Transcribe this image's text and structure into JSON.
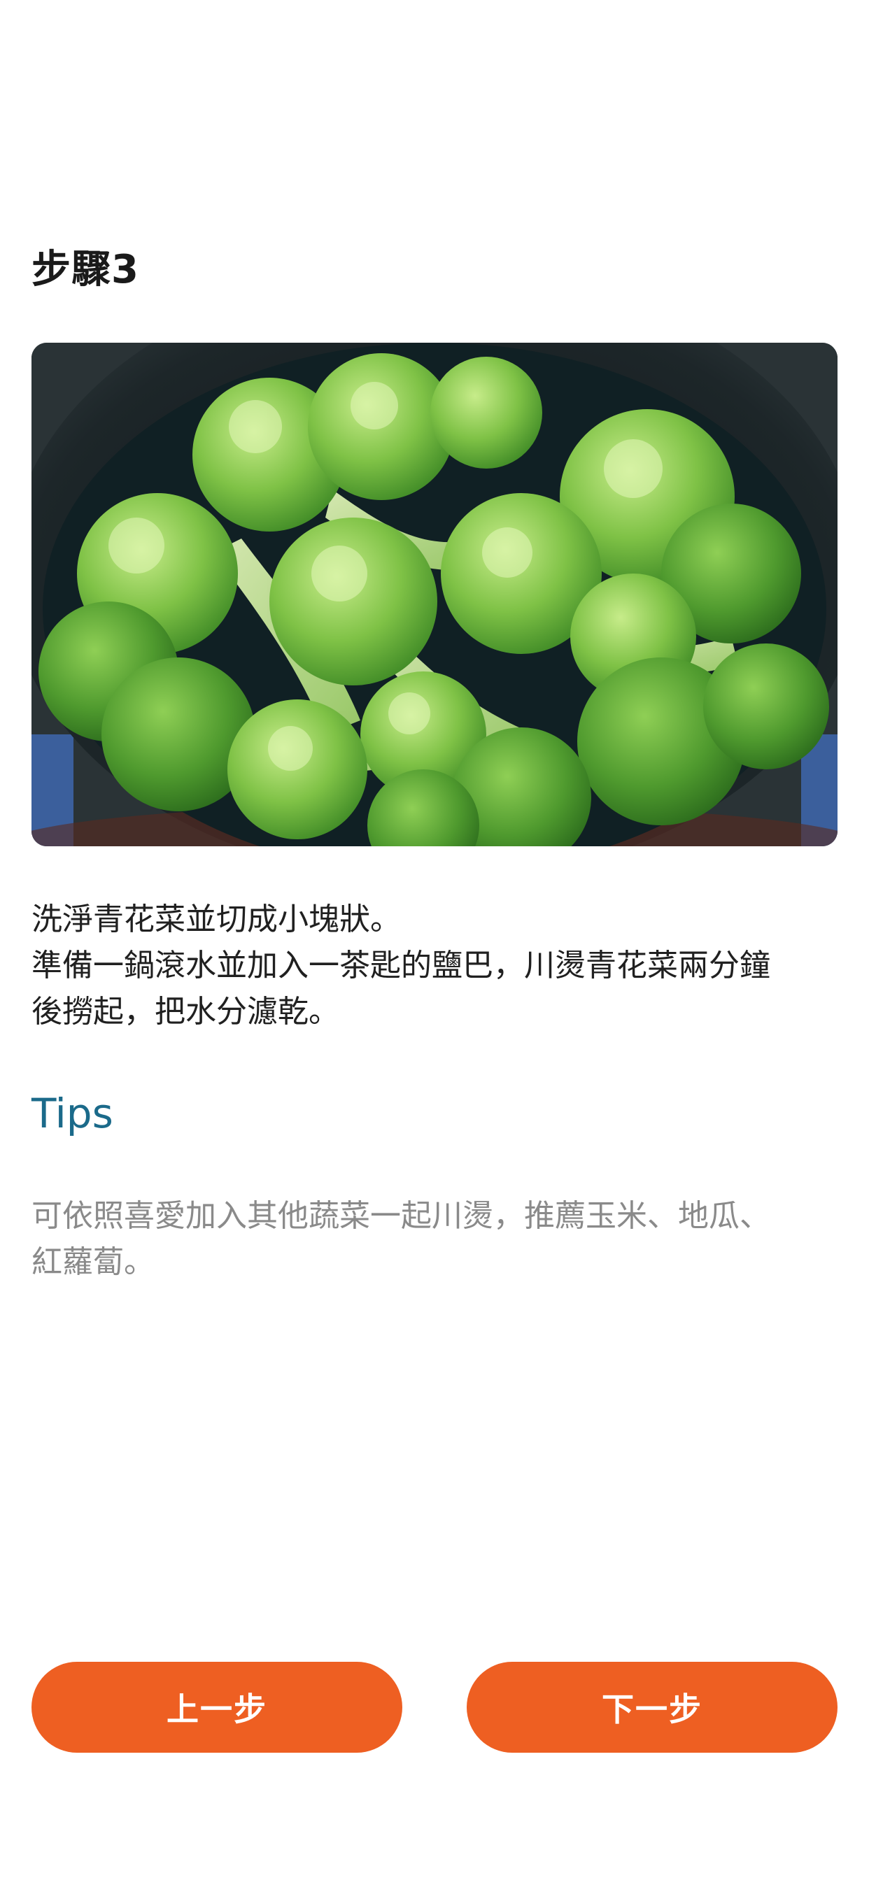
{
  "step": {
    "title": "步驟3"
  },
  "image": {
    "subject": "broccoli-in-pot-image",
    "colors": {
      "pot": "#1e272a",
      "broccoli_light": "#a6d86a",
      "broccoli_dark": "#3f8f2a"
    }
  },
  "description": {
    "lines": [
      "洗淨青花菜並切成小塊狀。",
      "準備一鍋滾水並加入一茶匙的鹽巴，川燙青花菜兩分鐘",
      "後撈起，把水分濾乾。"
    ]
  },
  "tips": {
    "heading": "Tips",
    "lines": [
      "可依照喜愛加入其他蔬菜一起川燙，推薦玉米、地瓜、",
      "紅蘿蔔。"
    ]
  },
  "buttons": {
    "prev_label": "上一步",
    "next_label": "下一步"
  },
  "colors": {
    "accent": "#ee5f22",
    "tips_heading": "#1b6a8a",
    "tips_text": "#8a8a8a"
  }
}
